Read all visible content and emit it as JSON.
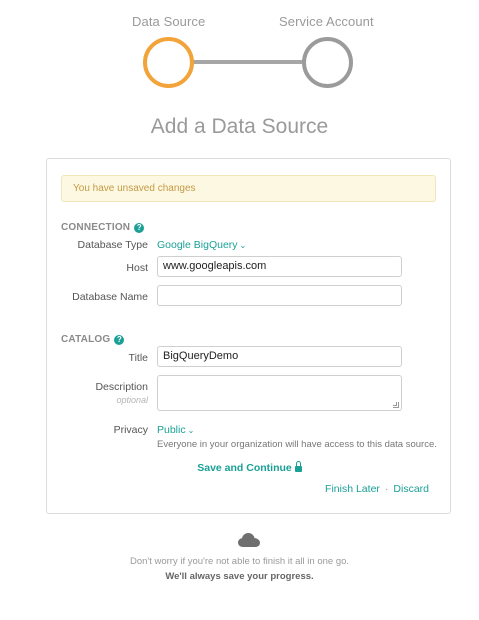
{
  "stepper": {
    "steps": [
      {
        "label": "Data Source",
        "state": "active"
      },
      {
        "label": "Service Account",
        "state": "inactive"
      }
    ],
    "active_color": "#f2a33a",
    "inactive_color": "#9b9b9b"
  },
  "title": "Add a Data Source",
  "alert": {
    "text": "You have unsaved changes"
  },
  "connection": {
    "heading": "CONNECTION",
    "help_icon": "question-circle-icon",
    "database_type": {
      "label": "Database Type",
      "value": "Google BigQuery"
    },
    "host": {
      "label": "Host",
      "value": "www.googleapis.com"
    },
    "database_name": {
      "label": "Database Name",
      "value": ""
    }
  },
  "catalog": {
    "heading": "CATALOG",
    "help_icon": "question-circle-icon",
    "title": {
      "label": "Title",
      "value": "BigQueryDemo"
    },
    "description": {
      "label": "Description",
      "sublabel": "optional",
      "value": ""
    },
    "privacy": {
      "label": "Privacy",
      "value": "Public",
      "help": "Everyone in your organization will have access to this data source."
    }
  },
  "actions": {
    "save": "Save and Continue",
    "save_icon": "lock-icon",
    "finish_later": "Finish Later",
    "separator": "·",
    "discard": "Discard"
  },
  "footer": {
    "icon": "cloud-icon",
    "line1": "Don't worry if you're not able to finish it all in one go.",
    "line2": "We'll always save your progress."
  },
  "accent_color": "#1aa097"
}
